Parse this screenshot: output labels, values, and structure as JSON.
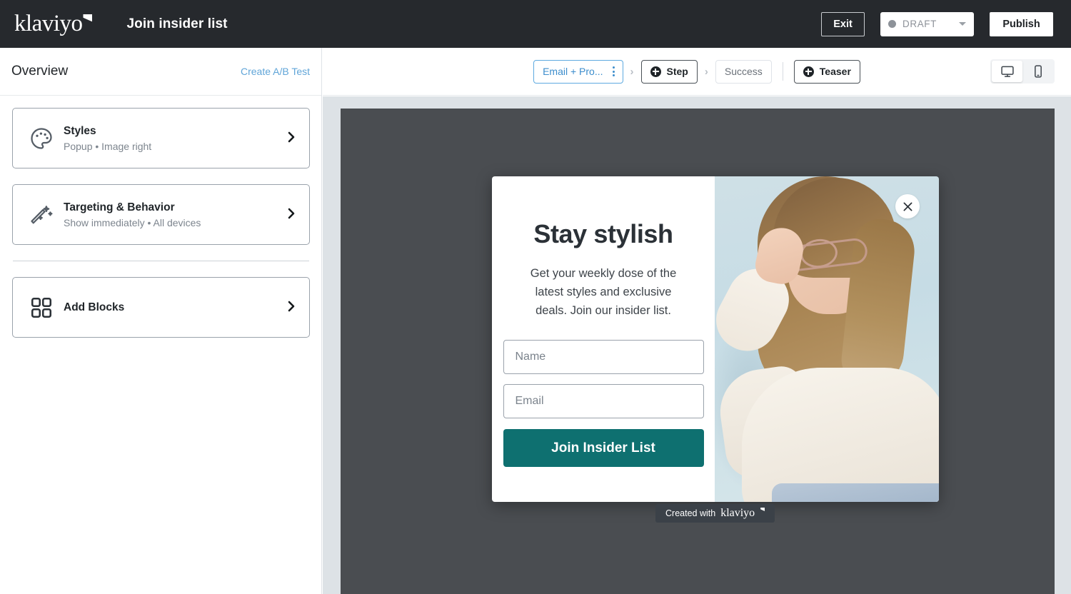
{
  "topbar": {
    "brand": "klaviyo",
    "doc_title": "Join insider list",
    "exit_label": "Exit",
    "status_label": "DRAFT",
    "publish_label": "Publish"
  },
  "sidebar": {
    "heading": "Overview",
    "ab_test_link": "Create A/B Test",
    "cards": [
      {
        "title": "Styles",
        "subtitle": "Popup • Image right",
        "icon": "palette-icon"
      },
      {
        "title": "Targeting & Behavior",
        "subtitle": "Show immediately • All devices",
        "icon": "magic-wand-icon"
      },
      {
        "title": "Add Blocks",
        "subtitle": "",
        "icon": "grid-blocks-icon"
      }
    ]
  },
  "canvas": {
    "steps": [
      {
        "label": "Email + Pro...",
        "state": "active",
        "menu": "kebab-menu"
      },
      {
        "label": "Step",
        "state": "add"
      },
      {
        "label": "Success",
        "state": "inactive"
      },
      {
        "label": "Teaser",
        "state": "add"
      }
    ],
    "devices": [
      {
        "name": "desktop",
        "selected": true
      },
      {
        "name": "mobile",
        "selected": false
      }
    ]
  },
  "popup": {
    "heading": "Stay stylish",
    "body": "Get your weekly dose of the latest styles and exclusive deals. Join our insider list.",
    "name_placeholder": "Name",
    "email_placeholder": "Email",
    "cta_label": "Join Insider List",
    "close_icon": "close-x-icon",
    "cta_color": "#0e7070",
    "image_alt": "woman-with-glasses-photo"
  },
  "badge": {
    "prefix": "Created with",
    "brand": "klaviyo"
  }
}
